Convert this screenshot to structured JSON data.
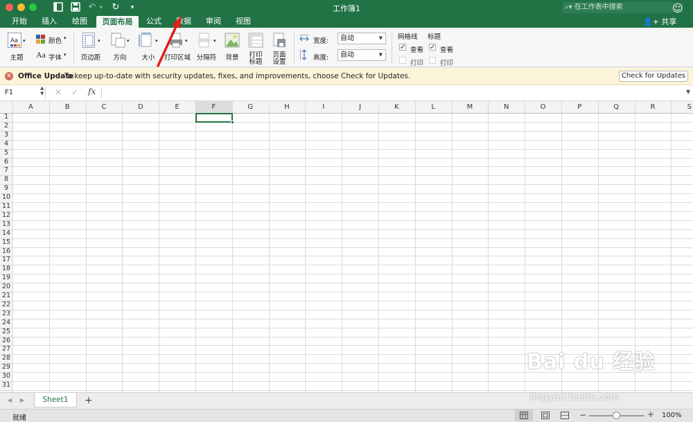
{
  "window": {
    "title": "工作簿1",
    "search_placeholder": "在工作表中搜索",
    "share_label": "共享"
  },
  "tabs": [
    "开始",
    "插入",
    "绘图",
    "页面布局",
    "公式",
    "数据",
    "审阅",
    "视图"
  ],
  "active_tab": "页面布局",
  "ribbon": {
    "theme": "主题",
    "colors": "颜色",
    "fonts": "字体",
    "margins": "页边距",
    "orientation": "方向",
    "size": "大小",
    "print_area": "打印区域",
    "breaks": "分隔符",
    "background": "背景",
    "print_titles_line1": "打印",
    "print_titles_line2": "标题",
    "page_setup_line1": "页面",
    "page_setup_line2": "设置",
    "width_label": "宽度:",
    "width_value": "自动",
    "height_label": "高度:",
    "height_value": "自动",
    "gridlines": "网格线",
    "headings": "标题",
    "view": "查看",
    "print": "打印",
    "gridlines_view_checked": true,
    "headings_view_checked": true,
    "gridlines_print_checked": false,
    "headings_print_checked": false
  },
  "update_bar": {
    "title": "Office Update",
    "message": "To keep up-to-date with security updates, fixes, and improvements, choose Check for Updates.",
    "button": "Check for Updates"
  },
  "formula_bar": {
    "name_box": "F1",
    "fx": "fx",
    "value": ""
  },
  "columns": [
    "A",
    "B",
    "C",
    "D",
    "E",
    "F",
    "G",
    "H",
    "I",
    "J",
    "K",
    "L",
    "M",
    "N",
    "O",
    "P",
    "Q",
    "R",
    "S"
  ],
  "rows": [
    "1",
    "2",
    "3",
    "4",
    "5",
    "6",
    "7",
    "8",
    "9",
    "10",
    "11",
    "12",
    "13",
    "14",
    "15",
    "16",
    "17",
    "18",
    "19",
    "20",
    "21",
    "22",
    "23",
    "24",
    "25",
    "26",
    "27",
    "28",
    "29",
    "30",
    "31"
  ],
  "selected_cell": "F1",
  "sheet_tabs": [
    "Sheet1"
  ],
  "status": {
    "ready": "就绪",
    "zoom": "100%"
  },
  "watermark": {
    "brand": "Bai du 经验",
    "url": "jingyan.baidu.com"
  },
  "colors": {
    "accent": "#217346",
    "annotation_arrow": "#e0201b",
    "update_bar": "#fcf4d9"
  }
}
